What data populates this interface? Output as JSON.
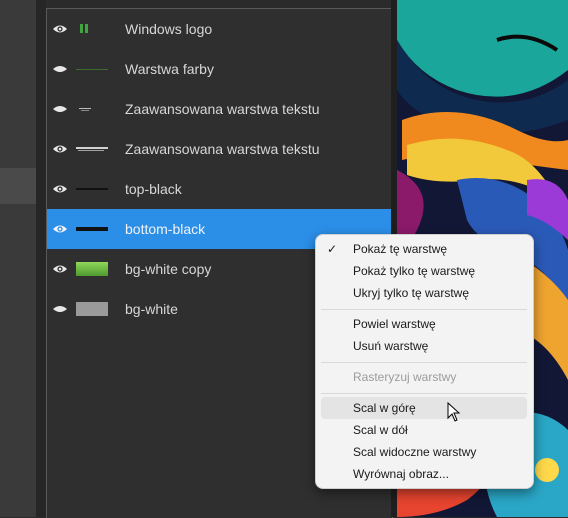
{
  "layers": [
    {
      "name": "Windows logo",
      "visible": true,
      "thumb": "windows-logo",
      "selected": false
    },
    {
      "name": "Warstwa farby",
      "visible": false,
      "thumb": "paint",
      "selected": false
    },
    {
      "name": "Zaawansowana warstwa tekstu",
      "visible": false,
      "thumb": "text-small",
      "selected": false
    },
    {
      "name": "Zaawansowana warstwa tekstu",
      "visible": true,
      "thumb": "text-wide",
      "selected": false
    },
    {
      "name": "top-black",
      "visible": true,
      "thumb": "line-thin",
      "selected": false
    },
    {
      "name": "bottom-black",
      "visible": true,
      "thumb": "line-thick",
      "selected": true
    },
    {
      "name": "bg-white copy",
      "visible": true,
      "thumb": "green",
      "selected": false
    },
    {
      "name": "bg-white",
      "visible": false,
      "thumb": "gray",
      "selected": false
    }
  ],
  "colors": {
    "selected_row": "#2b8fe8",
    "thumb_green": "#6fbf3f",
    "thumb_gray": "#9a9a9a"
  },
  "context_menu": {
    "items": [
      {
        "label": "Pokaż tę warstwę",
        "checked": true,
        "disabled": false
      },
      {
        "label": "Pokaż tylko tę warstwę",
        "checked": false,
        "disabled": false
      },
      {
        "label": "Ukryj tylko tę warstwę",
        "checked": false,
        "disabled": false
      },
      {
        "label": "Powiel warstwę",
        "checked": false,
        "disabled": false
      },
      {
        "label": "Usuń warstwę",
        "checked": false,
        "disabled": false
      },
      {
        "label": "Rasteryzuj warstwy",
        "checked": false,
        "disabled": true
      },
      {
        "label": "Scal w górę",
        "checked": false,
        "disabled": false,
        "hovered": true
      },
      {
        "label": "Scal w dół",
        "checked": false,
        "disabled": false
      },
      {
        "label": "Scal widoczne warstwy",
        "checked": false,
        "disabled": false
      },
      {
        "label": "Wyrównaj obraz...",
        "checked": false,
        "disabled": false
      }
    ]
  }
}
